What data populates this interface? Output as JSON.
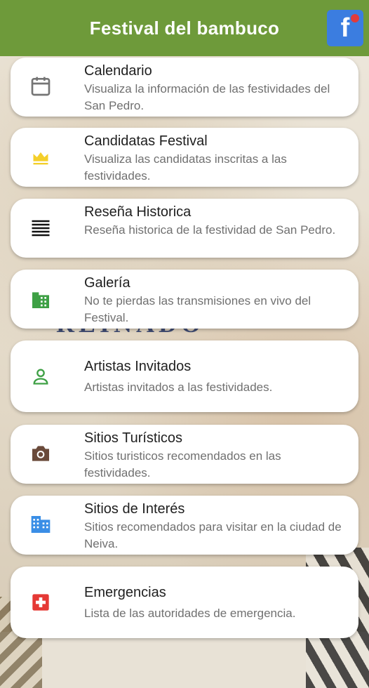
{
  "app_bar": {
    "title": "Festival del bambuco",
    "facebook_letter": "f"
  },
  "background": {
    "poster_text": "REINADO NACIONAL"
  },
  "menu": [
    {
      "icon": "calendar-icon",
      "title": "Calendario",
      "subtitle": "Visualiza la información de las festividades del San Pedro."
    },
    {
      "icon": "crown-icon",
      "title": "Candidatas Festival",
      "subtitle": "Visualiza las candidatas inscritas a las festividades."
    },
    {
      "icon": "list-lines-icon",
      "title": "Reseña Historica",
      "subtitle": "Reseña historica de la festividad de San Pedro."
    },
    {
      "icon": "gallery-icon",
      "title": "Galería",
      "subtitle": "No te pierdas las transmisiones en vivo del Festival."
    },
    {
      "icon": "person-icon",
      "title": "Artistas Invitados",
      "subtitle": "Artistas invitados a las festividades."
    },
    {
      "icon": "camera-icon",
      "title": "Sitios Turísticos",
      "subtitle": "Sitios turisticos recomendados en las festividades."
    },
    {
      "icon": "building-icon",
      "title": "Sitios de Interés",
      "subtitle": "Sitios recomendados para visitar en la ciudad de Neiva."
    },
    {
      "icon": "medical-cross-icon",
      "title": "Emergencias",
      "subtitle": "Lista de las autoridades de emergencia."
    }
  ],
  "colors": {
    "app_bar": "#6e9a3a",
    "facebook": "#3b7de0",
    "crown": "#f4cf2a",
    "gallery": "#3ea045",
    "person": "#3ea045",
    "camera": "#6a4a3a",
    "building": "#3a8ee6",
    "emergency": "#e53935"
  }
}
